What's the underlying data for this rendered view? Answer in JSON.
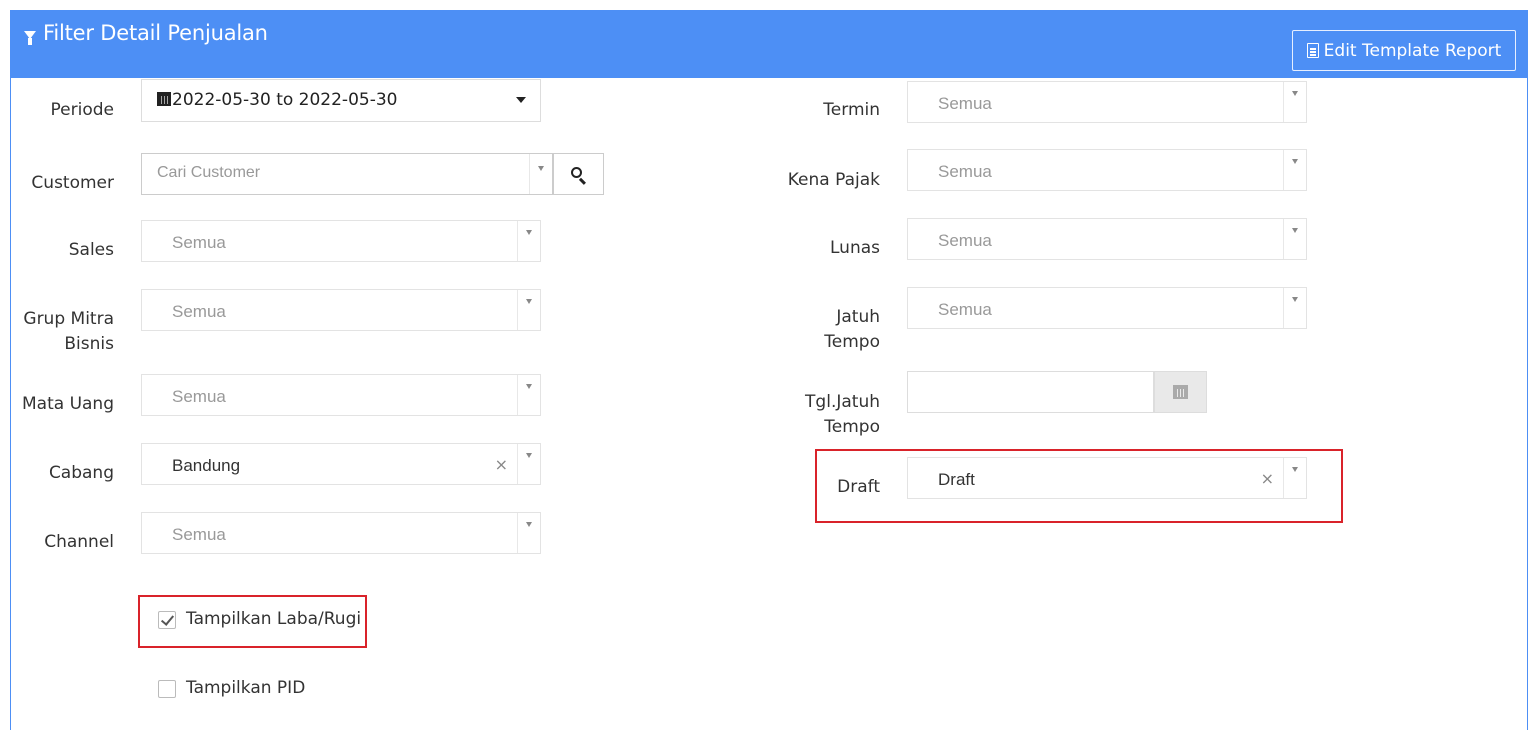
{
  "header": {
    "title": "Filter Detail Penjualan",
    "edit_button": "Edit Template Report"
  },
  "left": {
    "periode": {
      "label": "Periode",
      "value": "2022-05-30 to 2022-05-30"
    },
    "customer": {
      "label": "Customer",
      "placeholder": "Cari Customer"
    },
    "sales": {
      "label": "Sales",
      "value": "Semua"
    },
    "grup_mitra": {
      "label_line1": "Grup Mitra",
      "label_line2": "Bisnis",
      "value": "Semua"
    },
    "mata_uang": {
      "label": "Mata Uang",
      "value": "Semua"
    },
    "cabang": {
      "label": "Cabang",
      "value": "Bandung"
    },
    "channel": {
      "label": "Channel",
      "value": "Semua"
    }
  },
  "right": {
    "termin": {
      "label": "Termin",
      "value": "Semua"
    },
    "kena_pajak": {
      "label": "Kena Pajak",
      "value": "Semua"
    },
    "lunas": {
      "label": "Lunas",
      "value": "Semua"
    },
    "jatuh_tempo": {
      "label_line1": "Jatuh",
      "label_line2": "Tempo",
      "value": "Semua"
    },
    "tgl_jatuh_tempo": {
      "label_line1": "Tgl.Jatuh",
      "label_line2": "Tempo",
      "value": ""
    },
    "draft": {
      "label": "Draft",
      "value": "Draft"
    }
  },
  "checkboxes": {
    "laba_rugi": {
      "label": "Tampilkan Laba/Rugi",
      "checked": true
    },
    "pid": {
      "label": "Tampilkan PID",
      "checked": false
    }
  },
  "colors": {
    "header_bg": "#4d8ff5",
    "highlight": "#d9232a"
  }
}
